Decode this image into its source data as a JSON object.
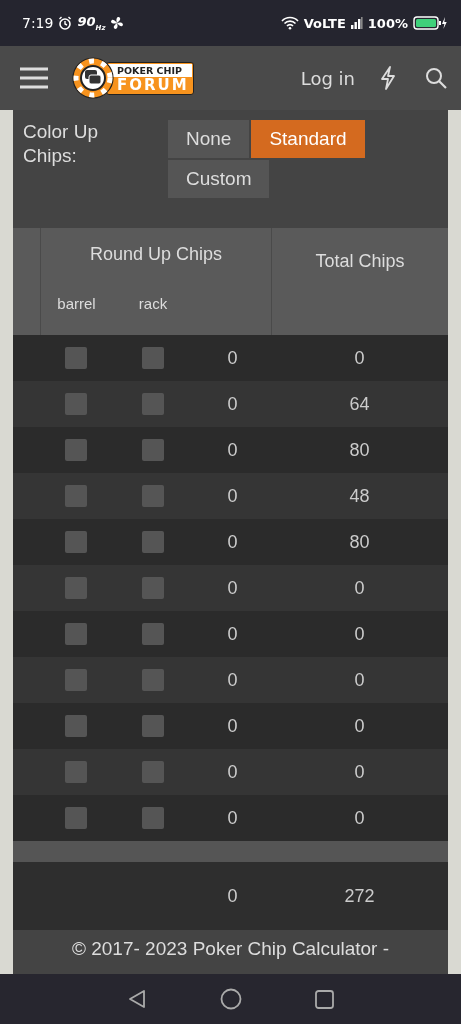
{
  "status_bar": {
    "time": "7:19",
    "refresh": "90",
    "refresh_unit": "Hz",
    "network": "VoLTE",
    "battery": "100%"
  },
  "header": {
    "logo_top": "POKER CHIP",
    "logo_bottom": "FORUM",
    "login": "Log in"
  },
  "color_up": {
    "label": "Color Up Chips:",
    "options": [
      {
        "label": "None",
        "selected": false
      },
      {
        "label": "Standard",
        "selected": true
      },
      {
        "label": "Custom",
        "selected": false
      }
    ]
  },
  "table": {
    "group_header": "Round Up Chips",
    "total_header": "Total Chips",
    "sub_headers": [
      "barrel",
      "rack"
    ],
    "rows": [
      {
        "barrel": false,
        "rack": false,
        "round_up": "0",
        "total": "0"
      },
      {
        "barrel": false,
        "rack": false,
        "round_up": "0",
        "total": "64"
      },
      {
        "barrel": false,
        "rack": false,
        "round_up": "0",
        "total": "80"
      },
      {
        "barrel": false,
        "rack": false,
        "round_up": "0",
        "total": "48"
      },
      {
        "barrel": false,
        "rack": false,
        "round_up": "0",
        "total": "80"
      },
      {
        "barrel": false,
        "rack": false,
        "round_up": "0",
        "total": "0"
      },
      {
        "barrel": false,
        "rack": false,
        "round_up": "0",
        "total": "0"
      },
      {
        "barrel": false,
        "rack": false,
        "round_up": "0",
        "total": "0"
      },
      {
        "barrel": false,
        "rack": false,
        "round_up": "0",
        "total": "0"
      },
      {
        "barrel": false,
        "rack": false,
        "round_up": "0",
        "total": "0"
      },
      {
        "barrel": false,
        "rack": false,
        "round_up": "0",
        "total": "0"
      }
    ],
    "totals": {
      "round_up": "0",
      "total": "272"
    }
  },
  "footer": {
    "text": "© 2017- 2023 Poker Chip Calculator -"
  }
}
